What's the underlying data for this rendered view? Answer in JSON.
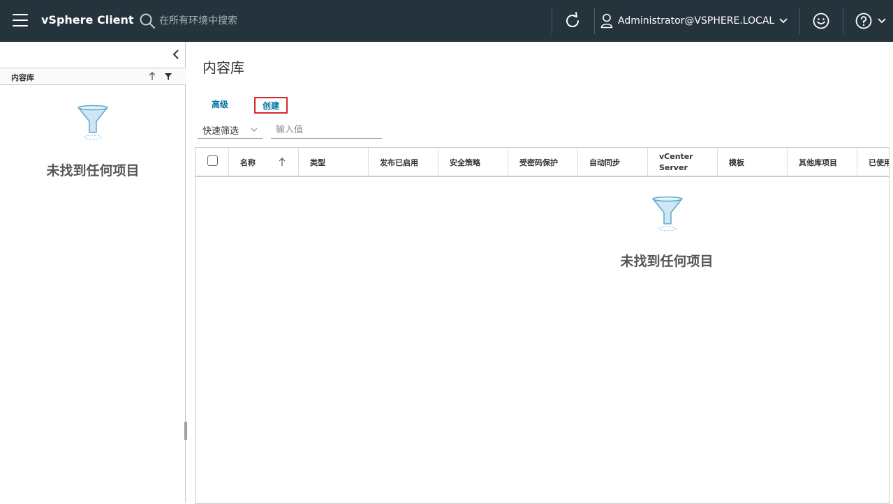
{
  "header": {
    "app_title": "vSphere Client",
    "search_placeholder": "在所有环境中搜索",
    "user_name": "Administrator@VSPHERE.LOCAL",
    "background_color": "#25333d",
    "icons": [
      "menu-icon",
      "search-icon",
      "refresh-icon",
      "user-icon",
      "chevron-down-icon",
      "smiley-icon",
      "help-icon"
    ]
  },
  "left_panel": {
    "tree_header_label": "内容库",
    "empty_text": "未找到任何项目",
    "icons": [
      "chevron-left-icon",
      "sort-up-icon",
      "filter-icon",
      "funnel-icon"
    ]
  },
  "main": {
    "page_title": "内容库",
    "actions": {
      "advanced_label": "高级",
      "create_label": "创建"
    },
    "filter": {
      "quick_filter_label": "快速筛选",
      "input_placeholder": "输入值"
    },
    "grid": {
      "columns": [
        {
          "label": "名称"
        },
        {
          "label": "类型"
        },
        {
          "label": "发布已启用"
        },
        {
          "label": "安全策略"
        },
        {
          "label": "受密码保护"
        },
        {
          "label": "自动同步"
        },
        {
          "label_line1": "vCenter",
          "label_line2": "Server"
        },
        {
          "label": "模板"
        },
        {
          "label": "其他库项目"
        },
        {
          "label": "已使用"
        }
      ],
      "empty_text": "未找到任何项目"
    },
    "accent_color": "#0072a3",
    "highlight_color": "#d4272d"
  }
}
